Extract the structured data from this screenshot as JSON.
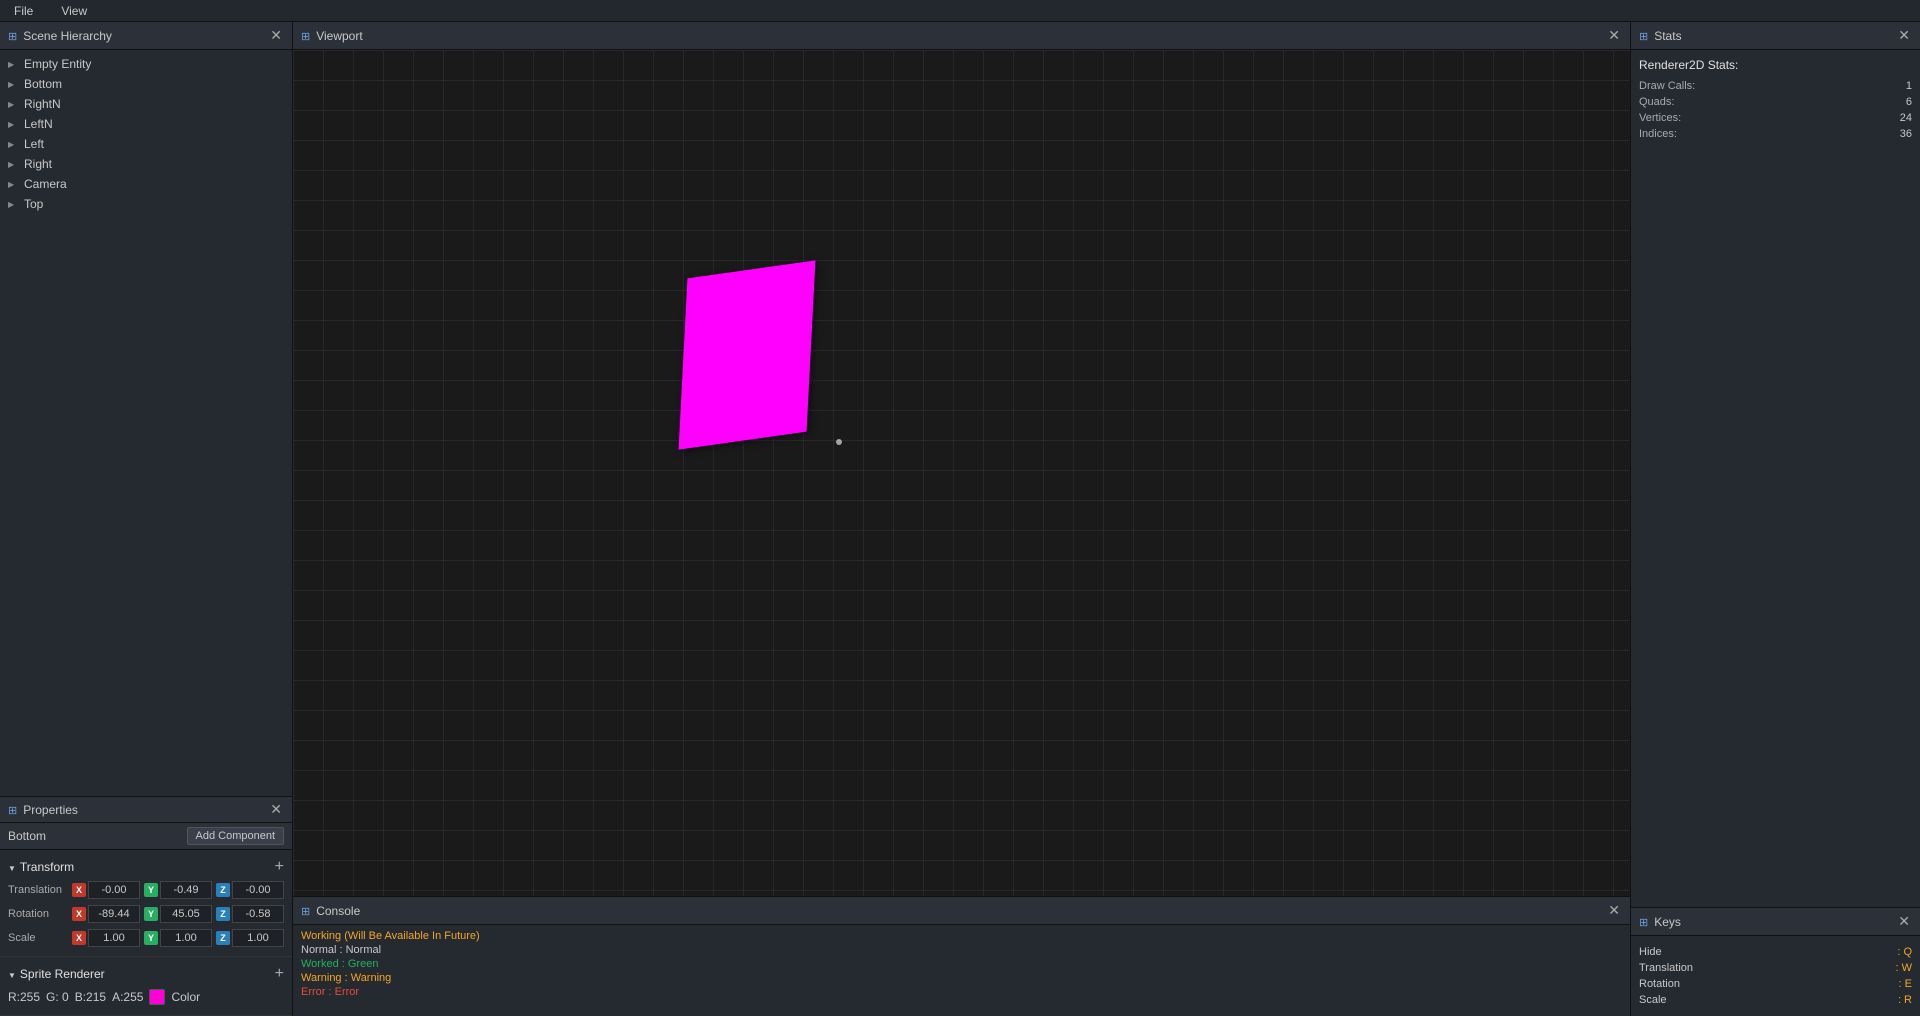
{
  "menubar": {
    "items": [
      "File",
      "View"
    ]
  },
  "scene_hierarchy": {
    "title": "Scene Hierarchy",
    "items": [
      {
        "label": "Empty Entity",
        "arrow": "right"
      },
      {
        "label": "Bottom",
        "arrow": "right"
      },
      {
        "label": "RightN",
        "arrow": "right"
      },
      {
        "label": "LeftN",
        "arrow": "right"
      },
      {
        "label": "Left",
        "arrow": "right"
      },
      {
        "label": "Right",
        "arrow": "right"
      },
      {
        "label": "Camera",
        "arrow": "right"
      },
      {
        "label": "Top",
        "arrow": "right"
      }
    ]
  },
  "properties": {
    "title": "Properties",
    "entity_name": "Bottom",
    "add_component_label": "Add Component",
    "transform": {
      "title": "Transform",
      "translation": {
        "label": "Translation",
        "x": "-0.00",
        "y": "-0.49",
        "z": "-0.00"
      },
      "rotation": {
        "label": "Rotation",
        "x": "-89.44",
        "y": "45.05",
        "z": "-0.58"
      },
      "scale": {
        "label": "Scale",
        "x": "1.00",
        "y": "1.00",
        "z": "1.00"
      }
    },
    "sprite_renderer": {
      "title": "Sprite Renderer",
      "r": "R:255",
      "g": "G: 0",
      "b": "B:215",
      "a": "A:255",
      "color_label": "Color",
      "color_hex": "#ff00d7"
    }
  },
  "viewport": {
    "title": "Viewport"
  },
  "console": {
    "title": "Console",
    "messages": [
      {
        "type": "working",
        "text": "Working (Will Be Available In Future)"
      },
      {
        "type": "normal",
        "text": "Normal : Normal"
      },
      {
        "type": "worked",
        "text": "Worked : Green"
      },
      {
        "type": "warning",
        "text": "Warning : Warning"
      },
      {
        "type": "error",
        "text": "Error : Error"
      }
    ]
  },
  "stats": {
    "title": "Stats",
    "section_title": "Renderer2D Stats:",
    "rows": [
      {
        "label": "Draw Calls:",
        "value": "1"
      },
      {
        "label": "Quads:",
        "value": "6"
      },
      {
        "label": "Vertices:",
        "value": "24"
      },
      {
        "label": "Indices:",
        "value": "36"
      }
    ]
  },
  "keys": {
    "title": "Keys",
    "rows": [
      {
        "label": "Hide",
        "key": ": Q"
      },
      {
        "label": "Translation",
        "key": ": W"
      },
      {
        "label": "Rotation",
        "key": ": E"
      },
      {
        "label": "Scale",
        "key": ": R"
      }
    ]
  },
  "icons": {
    "close": "✕",
    "widget": "⊞",
    "chevron_right": "▶",
    "chevron_down": "▼",
    "plus": "+"
  }
}
